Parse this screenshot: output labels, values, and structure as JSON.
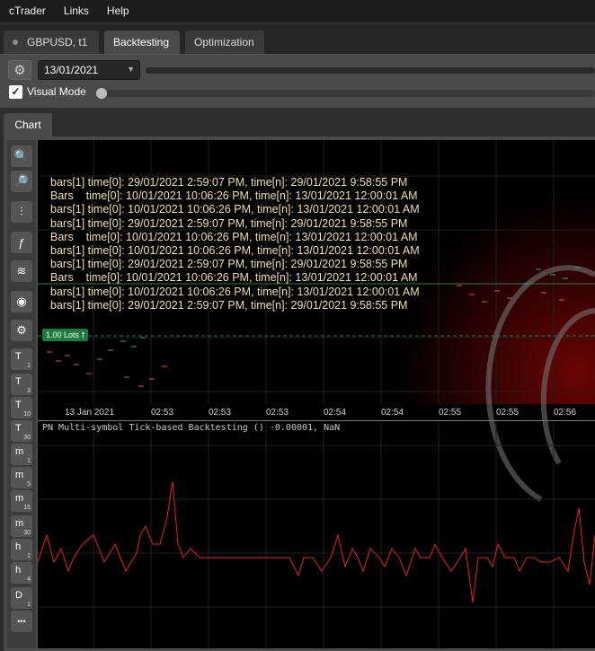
{
  "menu": [
    "cTrader",
    "Links",
    "Help"
  ],
  "tabs": {
    "symbol_tab": "GBPUSD, t1",
    "backtesting": "Backtesting",
    "optimization": "Optimization"
  },
  "toolbar": {
    "date": "13/01/2021",
    "visual_mode_label": "Visual Mode",
    "visual_mode_checked": true
  },
  "chart_tab": "Chart",
  "log_lines": [
    "bars[1] time[0]: 29/01/2021 2:59:07 PM, time[n]: 29/01/2021 9:58:55 PM",
    "Bars    time[0]: 10/01/2021 10:06:26 PM, time[n]: 13/01/2021 12:00:01 AM",
    "bars[1] time[0]: 10/01/2021 10:06:26 PM, time[n]: 13/01/2021 12:00:01 AM",
    "bars[1] time[0]: 29/01/2021 2:59:07 PM, time[n]: 29/01/2021 9:58:55 PM",
    "Bars    time[0]: 10/01/2021 10:06:26 PM, time[n]: 13/01/2021 12:00:01 AM",
    "bars[1] time[0]: 10/01/2021 10:06:26 PM, time[n]: 13/01/2021 12:00:01 AM",
    "bars[1] time[0]: 29/01/2021 2:59:07 PM, time[n]: 29/01/2021 9:58:55 PM",
    "Bars    time[0]: 10/01/2021 10:06:26 PM, time[n]: 13/01/2021 12:00:01 AM",
    "bars[1] time[0]: 10/01/2021 10:06:26 PM, time[n]: 13/01/2021 12:00:01 AM",
    "bars[1] time[0]: 29/01/2021 2:59:07 PM, time[n]: 29/01/2021 9:58:55 PM"
  ],
  "lots_label": "1.00 Lots",
  "time_ticks": [
    "13 Jan 2021",
    "02:53",
    "02:53",
    "02:53",
    "02:54",
    "02:54",
    "02:55",
    "02:55",
    "02:56"
  ],
  "indicator_label": "PN Multi-symbol Tick-based Backtesting () -0.00001, NaN",
  "side_tools": [
    {
      "icon": "zoom-in-icon"
    },
    {
      "icon": "zoom-out-icon"
    },
    {
      "icon": "chart-type-icon"
    },
    {
      "icon": "indicators-icon"
    },
    {
      "icon": "layers-icon"
    },
    {
      "icon": "eye-icon"
    },
    {
      "icon": "settings-icon"
    },
    {
      "main": "T",
      "sub": "1"
    },
    {
      "main": "T",
      "sub": "3"
    },
    {
      "main": "T",
      "sub": "10"
    },
    {
      "main": "T",
      "sub": "30"
    },
    {
      "main": "m",
      "sub": "1"
    },
    {
      "main": "m",
      "sub": "5"
    },
    {
      "main": "m",
      "sub": "15"
    },
    {
      "main": "m",
      "sub": "30"
    },
    {
      "main": "h",
      "sub": "1"
    },
    {
      "main": "h",
      "sub": "4"
    },
    {
      "main": "D",
      "sub": "1"
    },
    {
      "icon": "more-icon"
    }
  ],
  "colors": {
    "accent_red": "#e22424",
    "log_text": "#f3dfb0",
    "lots_green": "#1d7a3e"
  }
}
